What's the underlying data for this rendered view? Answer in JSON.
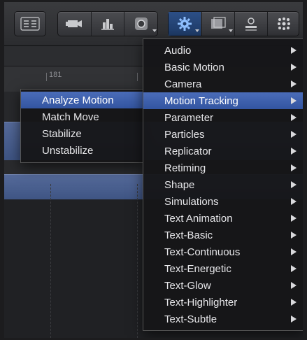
{
  "toolbar": {
    "groups": [
      {
        "icons": [
          "inspector-layout-icon"
        ]
      },
      {
        "icons": [
          "camera-icon",
          "behavior-icon",
          "mask-icon"
        ]
      },
      {
        "icons": [
          "gear-icon",
          "filters-icon",
          "generators-icon",
          "particles-icon"
        ]
      }
    ]
  },
  "timeline": {
    "ruler_label": "181"
  },
  "menu": {
    "items": [
      {
        "label": "Audio"
      },
      {
        "label": "Basic Motion"
      },
      {
        "label": "Camera"
      },
      {
        "label": "Motion Tracking"
      },
      {
        "label": "Parameter"
      },
      {
        "label": "Particles"
      },
      {
        "label": "Replicator"
      },
      {
        "label": "Retiming"
      },
      {
        "label": "Shape"
      },
      {
        "label": "Simulations"
      },
      {
        "label": "Text Animation"
      },
      {
        "label": "Text-Basic"
      },
      {
        "label": "Text-Continuous"
      },
      {
        "label": "Text-Energetic"
      },
      {
        "label": "Text-Glow"
      },
      {
        "label": "Text-Highlighter"
      },
      {
        "label": "Text-Subtle"
      }
    ],
    "highlighted": "Motion Tracking"
  },
  "submenu": {
    "items": [
      {
        "label": "Analyze Motion"
      },
      {
        "label": "Match Move"
      },
      {
        "label": "Stabilize"
      },
      {
        "label": "Unstabilize"
      }
    ],
    "highlighted": "Analyze Motion"
  },
  "colors": {
    "highlight": "#3f61ad",
    "track": "#4b5f8f"
  }
}
